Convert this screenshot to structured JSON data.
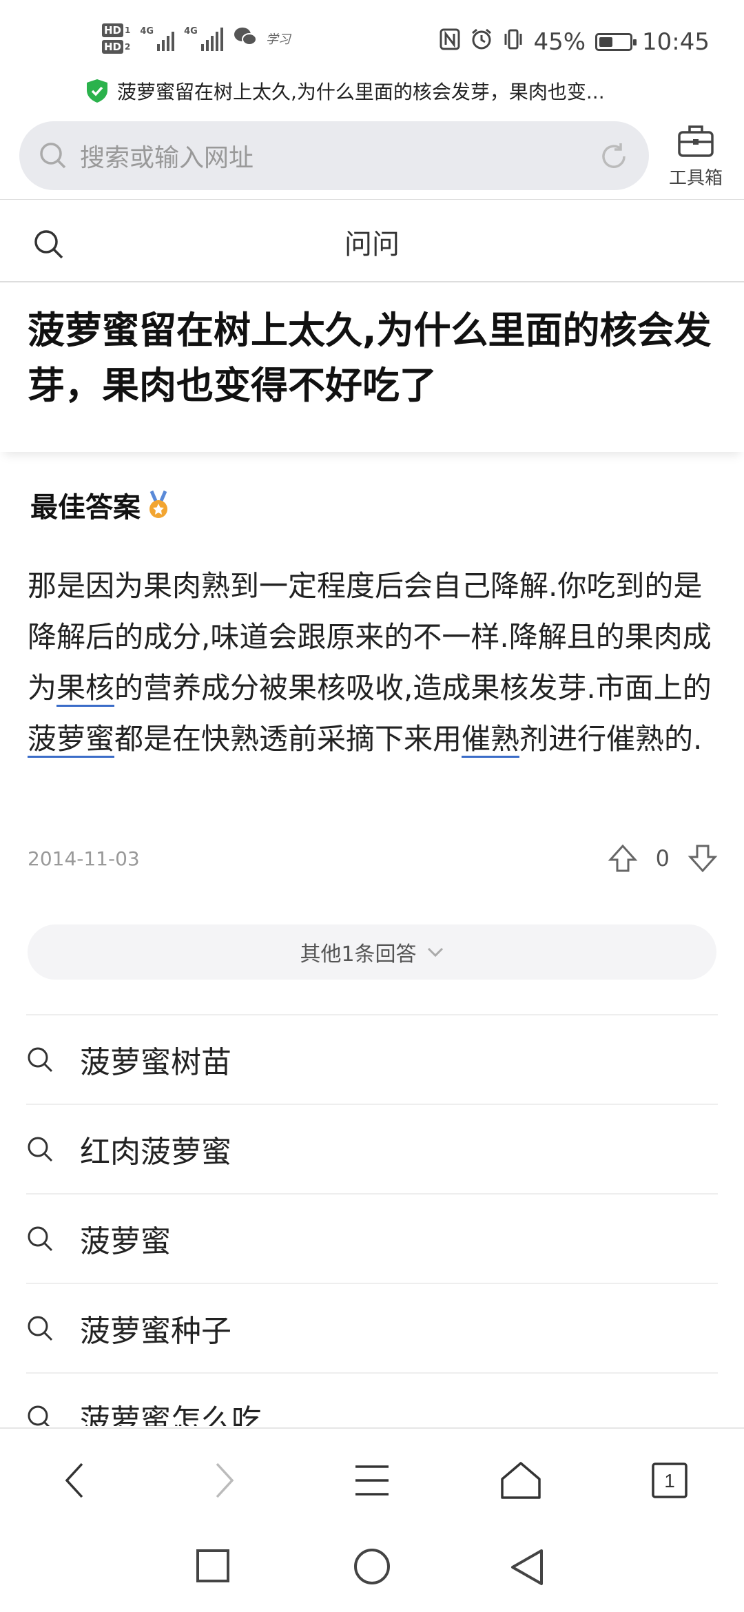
{
  "status_bar": {
    "hd1": "HD",
    "hd1_num": "1",
    "hd2": "HD",
    "hd2_num": "2",
    "sig1_label": "4G",
    "sig2_label": "4G",
    "app_badge": "学习",
    "battery_percent": "45%",
    "battery_level": 0.45,
    "time": "10:45",
    "icons": [
      "nfc-icon",
      "alarm-icon",
      "vibrate-icon"
    ]
  },
  "browser": {
    "page_title": "菠萝蜜留在树上太久,为什么里面的核会发芽，果肉也变...",
    "search_placeholder": "搜索或输入网址",
    "toolbox_label": "工具箱"
  },
  "site": {
    "title": "问问"
  },
  "question": {
    "title": "菠萝蜜留在树上太久,为什么里面的核会发芽，果肉也变得不好吃了"
  },
  "best_answer": {
    "label": "最佳答案",
    "text_parts": {
      "p1": "那是因为果肉熟到一定程度后会自己降解.你吃到的是降解后的成分,味道会跟原来的不一样.降解且的果肉成为",
      "k1": "果核",
      "p2": "的营养成分被果核吸收,造成果核发芽.市面上的",
      "k2": "菠萝蜜",
      "p3": "都是在快熟透前采摘下来用",
      "k3": "催熟",
      "p4": "剂进行催熟的."
    },
    "date": "2014-11-03",
    "votes": "0"
  },
  "more_answers": {
    "label": "其他1条回答"
  },
  "related": [
    {
      "label": "菠萝蜜树苗"
    },
    {
      "label": "红肉菠萝蜜"
    },
    {
      "label": "菠萝蜜"
    },
    {
      "label": "菠萝蜜种子"
    },
    {
      "label": "菠萝蜜怎么吃"
    }
  ],
  "bottom_nav": {
    "tab_count": "1"
  },
  "colors": {
    "accent_underline": "#3a6cc8",
    "shield_green": "#2bb24c",
    "medal_gold": "#f2a531"
  }
}
